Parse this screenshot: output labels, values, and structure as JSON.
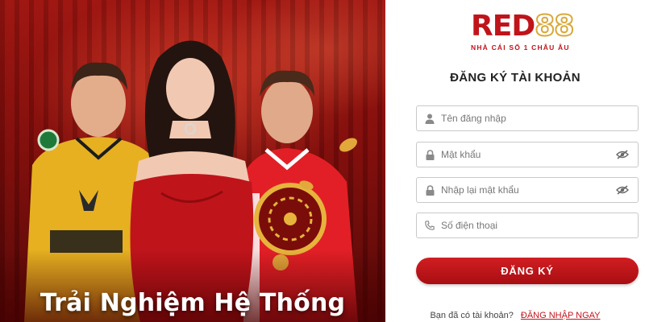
{
  "banner": {
    "title": "Trải Nghiệm Hệ Thống",
    "colors": {
      "background": "#7c0c0a",
      "dress": "#c0141b"
    }
  },
  "brand": {
    "logo_main": "RED",
    "logo_digits": "88",
    "tagline": "NHÀ CÁI SỐ 1 CHÂU ÂU",
    "colors": {
      "primary": "#c0141b",
      "gold": "#d9a93a"
    }
  },
  "form": {
    "title": "ĐĂNG KÝ TÀI KHOẢN",
    "fields": [
      {
        "icon": "user-icon",
        "placeholder": "Tên đăng nhập",
        "value": ""
      },
      {
        "icon": "lock-icon",
        "placeholder": "Mật khẩu",
        "value": "",
        "toggle_icon": "eye-slash-icon"
      },
      {
        "icon": "lock-icon",
        "placeholder": "Nhập lại mật khẩu",
        "value": "",
        "toggle_icon": "eye-slash-icon"
      },
      {
        "icon": "phone-icon",
        "placeholder": "Số điện thoại",
        "value": ""
      }
    ],
    "submit_label": "ĐĂNG KÝ",
    "login_prompt": "Bạn đã có tài khoản?",
    "login_link": "ĐĂNG NHẬP NGAY"
  }
}
